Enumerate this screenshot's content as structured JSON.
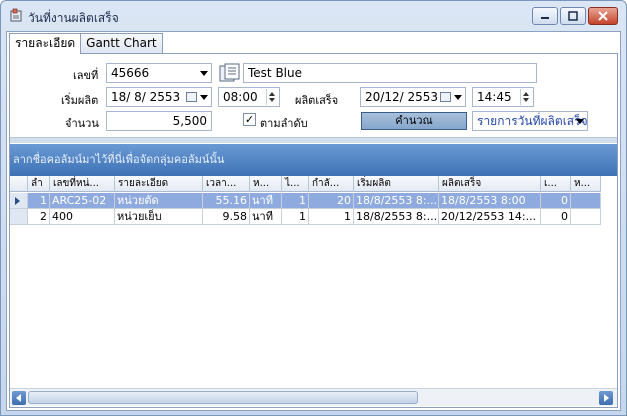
{
  "window": {
    "title": "วันที่งานผลิตเสร็จ",
    "controls": [
      "minimize",
      "maximize",
      "close"
    ]
  },
  "tabs": [
    {
      "label": "รายละเอียด",
      "active": true
    },
    {
      "label": "Gantt Chart",
      "active": false
    }
  ],
  "form": {
    "doc_no_label": "เลขที่",
    "doc_no_value": "45666",
    "product_name": "Test Blue",
    "start_label": "เริ่มผลิต",
    "start_date": "18/ 8/ 2553",
    "start_time": "08:00",
    "finish_label": "ผลิตเสร็จ",
    "finish_date": "20/12/ 2553",
    "finish_time": "14:45",
    "qty_label": "จำนวน",
    "qty_value": "5,500",
    "sequence_checkbox_label": "ตามลำดับ",
    "sequence_checked": true,
    "calc_button": "คำนวณ",
    "report_select_value": "รายการวันที่ผลิตเสร็จ"
  },
  "grid": {
    "group_hint": "ลากชื่อคอลัมน์มาไว้ที่นี่เพื่อจัดกลุ่มคอลัมน์นั้น",
    "columns": [
      "ลำ",
      "เลขที่หน่...",
      "รายละเอียด",
      "เวลา...",
      "ห...",
      "ไ...",
      "กำลั...",
      "เริ่มผลิต",
      "ผลิตเสร็จ",
      "เ...",
      "ห..."
    ],
    "rows": [
      {
        "seq": "1",
        "code": "ARC25-02",
        "detail": "หน่วยตัด",
        "time": "55.16",
        "unit": "นาที",
        "c6": "1",
        "c7": "20",
        "start": "18/8/2553 8:...",
        "finish": "18/8/2553 8:00",
        "c10": "0",
        "c11": "",
        "selected": true
      },
      {
        "seq": "2",
        "code": "400",
        "detail": "หน่วยเย็บ",
        "time": "9.58",
        "unit": "นาที",
        "c6": "1",
        "c7": "1",
        "start": "18/8/2553 8:...",
        "finish": "20/12/2553 14:...",
        "c10": "0",
        "c11": "",
        "selected": false
      }
    ]
  },
  "colors": {
    "accent": "#3e72b5",
    "selection": "#8faadf",
    "close_button": "#c4432b"
  }
}
